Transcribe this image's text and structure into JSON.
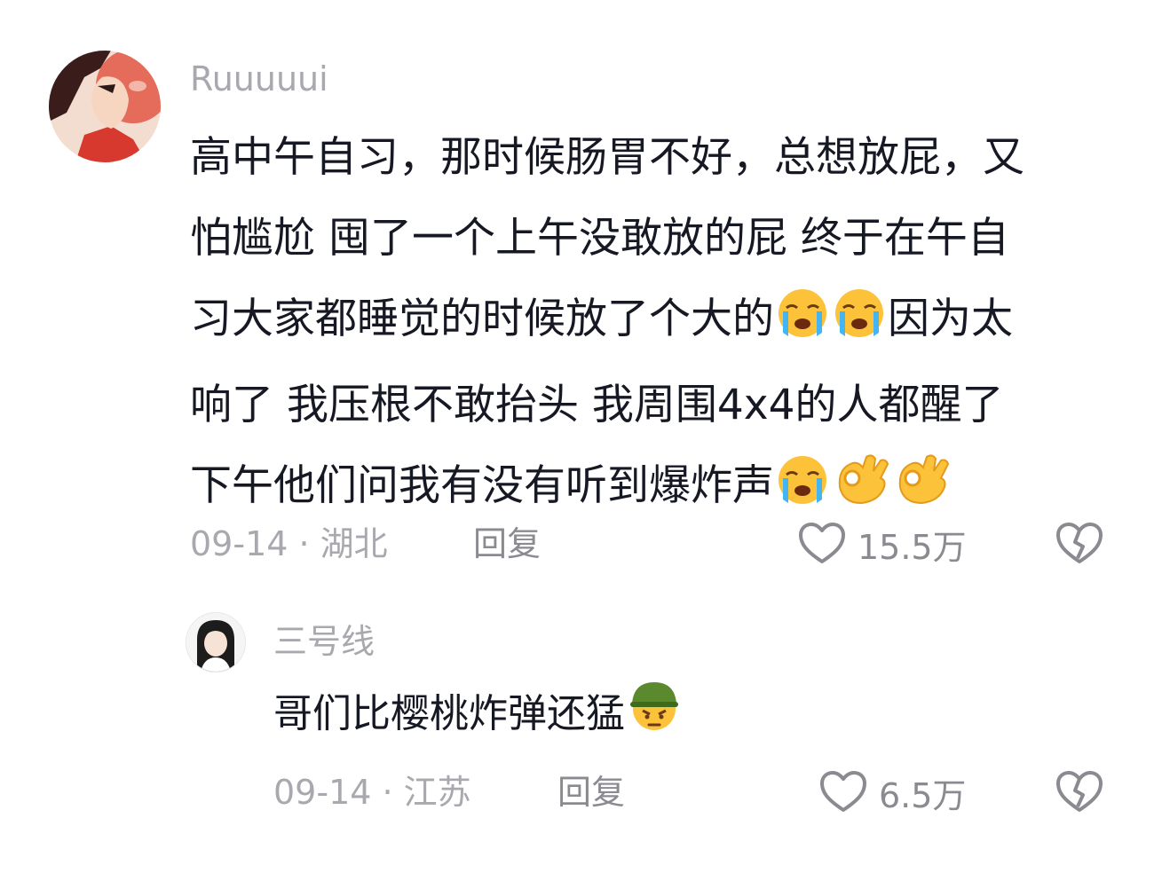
{
  "comments": [
    {
      "username": "Ruuuuui",
      "lines": [
        {
          "text": "高中午自习，那时候肠胃不好，总想放屁，又",
          "emojis": []
        },
        {
          "text": "怕尴尬 囤了一个上午没敢放的屁 终于在午自",
          "emojis": []
        },
        {
          "text": "习大家都睡觉的时候放了个大的",
          "emojis": [
            "loudly-crying-face",
            "loudly-crying-face"
          ],
          "tail": "因为太"
        },
        {
          "text": "响了 我压根不敢抬头 我周围4x4的人都醒了",
          "emojis": []
        },
        {
          "text": "下午他们问我有没有听到爆炸声",
          "emojis": [
            "loudly-crying-face",
            "ok-hand",
            "ok-hand"
          ]
        }
      ],
      "date": "09-14",
      "location": "湖北",
      "reply_label": "回复",
      "like_count": "15.5万"
    },
    {
      "username": "三号线",
      "lines": [
        {
          "text": "哥们比樱桃炸弹还猛",
          "emojis": [
            "soldier-face"
          ]
        }
      ],
      "date": "09-14",
      "location": "江苏",
      "reply_label": "回复",
      "like_count": "6.5万"
    }
  ],
  "meta_separator": " · ",
  "colors": {
    "text": "#161823",
    "muted": "#a8a8ae",
    "action": "#8a8a91"
  },
  "icons": {
    "like": "heart-outline-icon",
    "dislike": "broken-heart-icon"
  }
}
